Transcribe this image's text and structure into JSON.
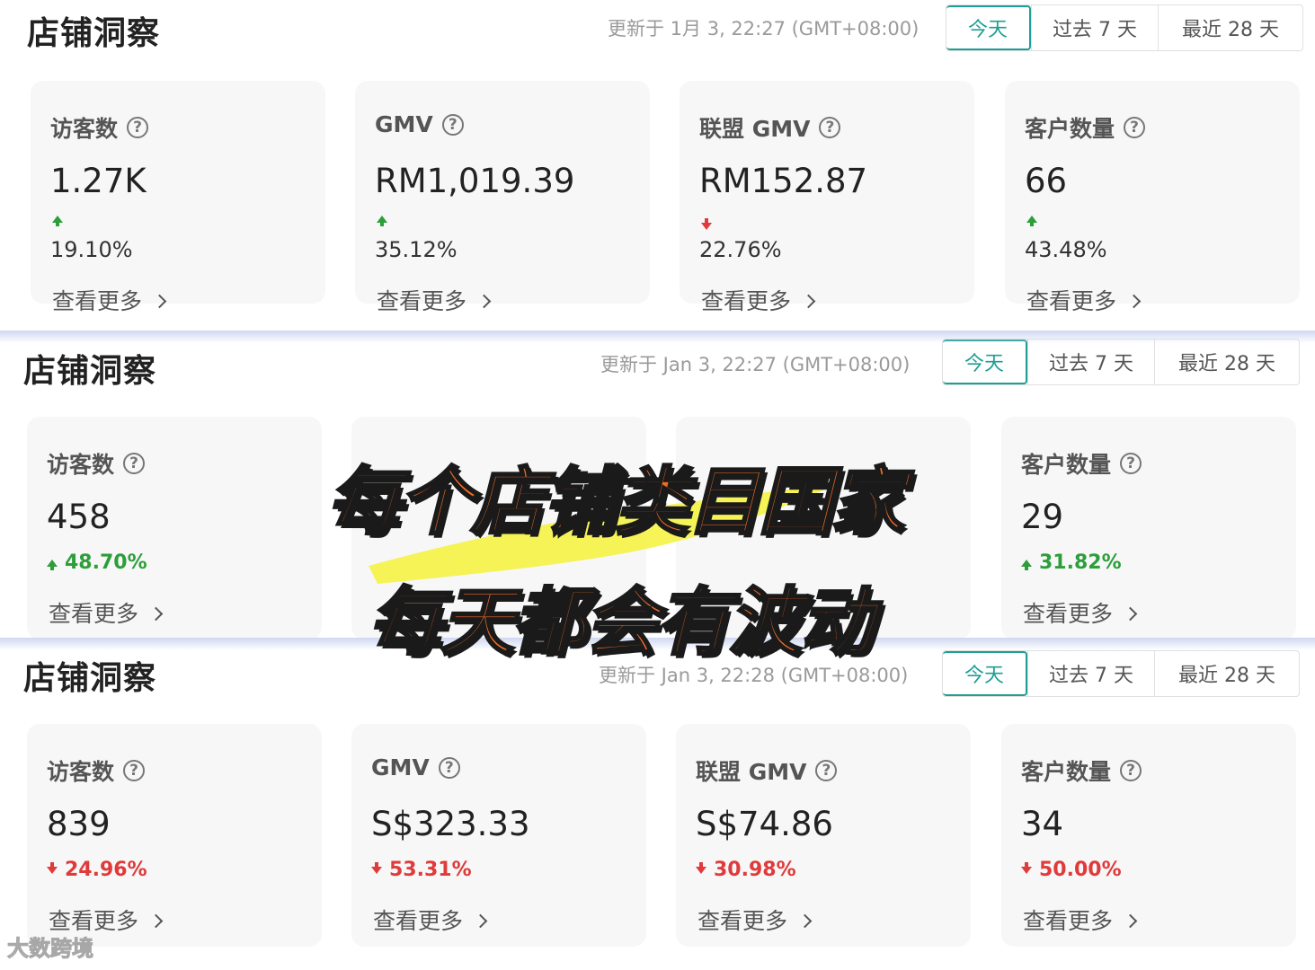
{
  "panels": [
    {
      "title": "店铺洞察",
      "updated": "更新于 1月 3, 22:27 (GMT+08:00)",
      "ranges": [
        "今天",
        "过去 7 天",
        "最近 28 天"
      ],
      "cards": [
        {
          "label": "访客数",
          "value": "1.27K",
          "change": "19.10%",
          "dir": "up",
          "more": "查看更多"
        },
        {
          "label": "GMV",
          "value": "RM1,019.39",
          "change": "35.12%",
          "dir": "up",
          "more": "查看更多"
        },
        {
          "label": "联盟 GMV",
          "value": "RM152.87",
          "change": "22.76%",
          "dir": "down",
          "more": "查看更多"
        },
        {
          "label": "客户数量",
          "value": "66",
          "change": "43.48%",
          "dir": "up",
          "more": "查看更多"
        }
      ]
    },
    {
      "title": "店铺洞察",
      "updated": "更新于 Jan 3, 22:27 (GMT+08:00)",
      "ranges": [
        "今天",
        "过去 7 天",
        "最近 28 天"
      ],
      "cards": [
        {
          "label": "访客数",
          "value": "458",
          "change": "48.70%",
          "dir": "up",
          "more": "查看更多"
        },
        {
          "label": "客户数量",
          "value": "29",
          "change": "31.82%",
          "dir": "up",
          "more": "查看更多"
        }
      ]
    },
    {
      "title": "店铺洞察",
      "updated": "更新于 Jan 3, 22:28 (GMT+08:00)",
      "ranges": [
        "今天",
        "过去 7 天",
        "最近 28 天"
      ],
      "cards": [
        {
          "label": "访客数",
          "value": "839",
          "change": "24.96%",
          "dir": "down",
          "more": "查看更多"
        },
        {
          "label": "GMV",
          "value": "S$323.33",
          "change": "53.31%",
          "dir": "down",
          "more": "查看更多"
        },
        {
          "label": "联盟 GMV",
          "value": "S$74.86",
          "change": "30.98%",
          "dir": "down",
          "more": "查看更多"
        },
        {
          "label": "客户数量",
          "value": "34",
          "change": "50.00%",
          "dir": "down",
          "more": "查看更多"
        }
      ]
    }
  ],
  "caption": {
    "line1": "每个店铺类目国家",
    "line2": "每天都会有波动",
    "color": "#f26b26"
  },
  "watermark": "大数跨境",
  "colors": {
    "accent": "#1e9e94",
    "up": "#2e9e3a",
    "down": "#e03a3a"
  }
}
